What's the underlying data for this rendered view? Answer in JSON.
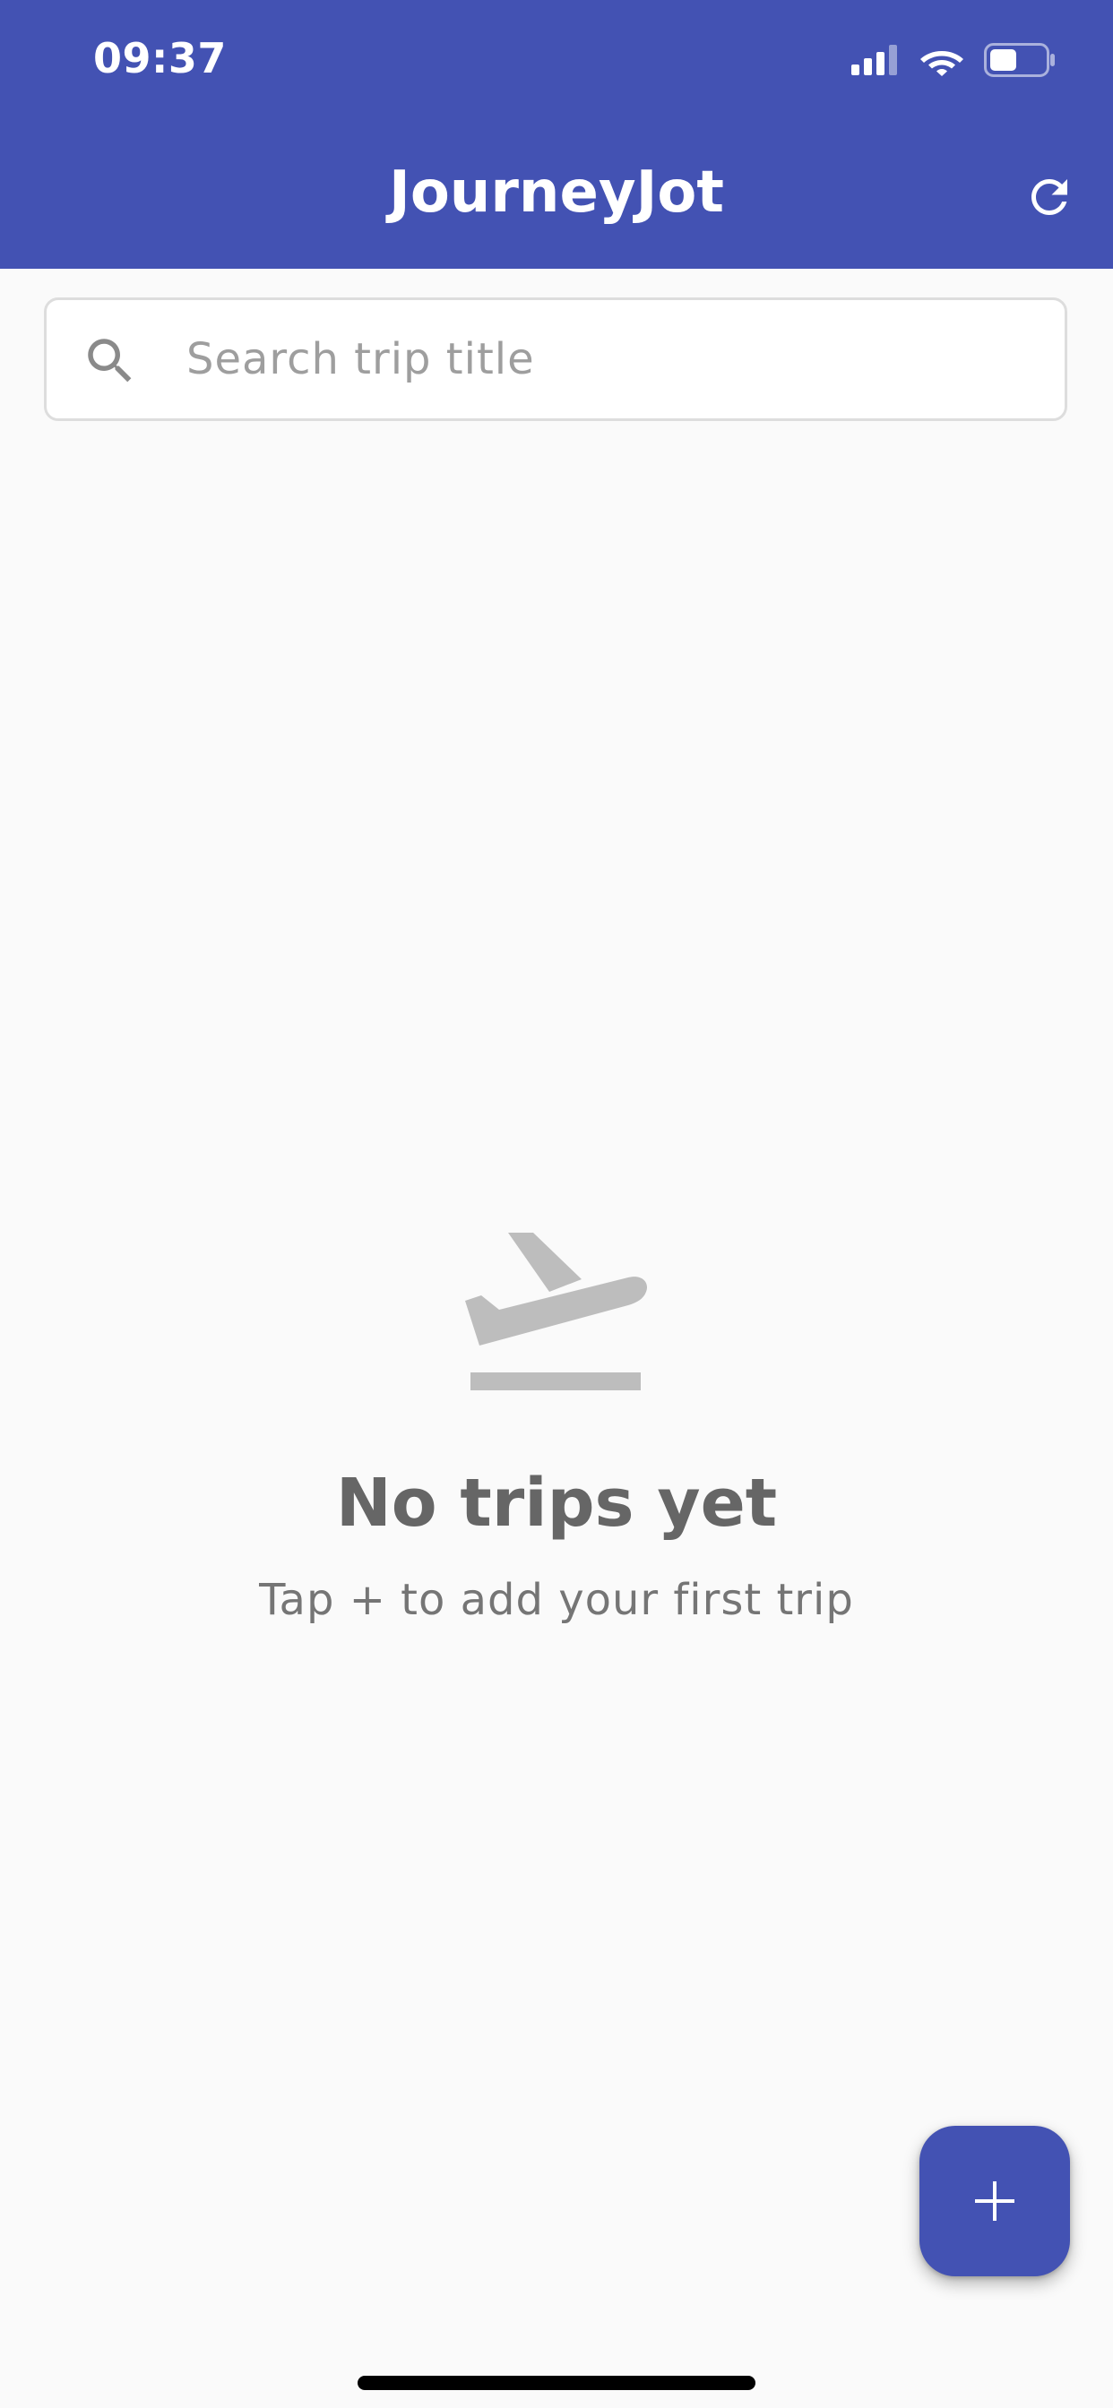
{
  "status_bar": {
    "time": "09:37",
    "icons": [
      "cellular-signal-icon",
      "wifi-icon",
      "battery-icon"
    ],
    "battery_level": 0.45
  },
  "header": {
    "title": "JourneyJot",
    "action_icon": "refresh-icon"
  },
  "search": {
    "placeholder": "Search trip title",
    "value": "",
    "icon": "search-icon"
  },
  "empty_state": {
    "icon": "flight-takeoff-icon",
    "title": "No trips yet",
    "subtitle": "Tap + to add your first trip"
  },
  "fab": {
    "icon": "plus-icon"
  },
  "colors": {
    "primary": "#4352B3",
    "background": "#FAFAFA",
    "empty_icon": "#BDBDBD",
    "title_text": "#666666",
    "subtitle_text": "#757575"
  }
}
